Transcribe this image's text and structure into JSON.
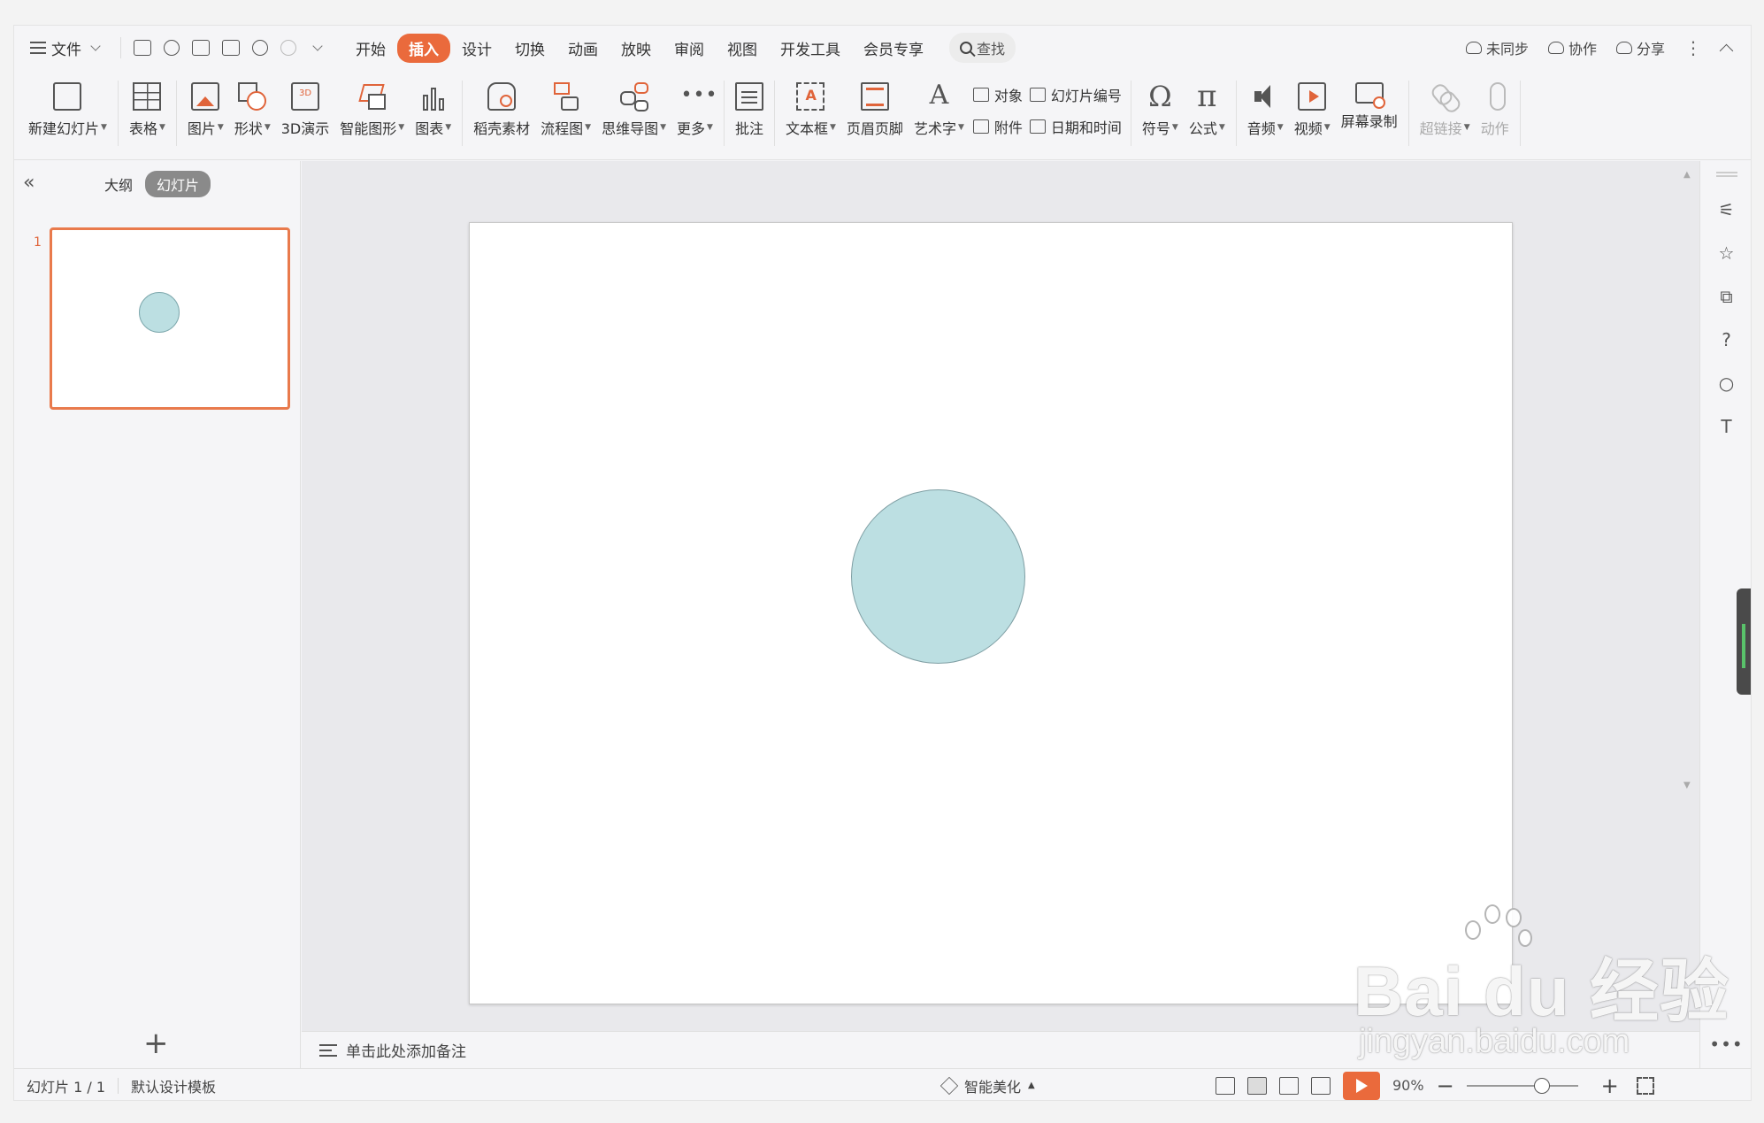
{
  "menubar": {
    "file_label": "文件",
    "tabs": [
      "开始",
      "插入",
      "设计",
      "切换",
      "动画",
      "放映",
      "审阅",
      "视图",
      "开发工具",
      "会员专享"
    ],
    "active_tab": "插入",
    "search_label": "查找",
    "right": {
      "sync_label": "未同步",
      "collab_label": "协作",
      "share_label": "分享"
    }
  },
  "ribbon": {
    "new_slide": "新建幻灯片",
    "table": "表格",
    "picture": "图片",
    "shape": "形状",
    "demo3d": "3D演示",
    "smart_graphic": "智能图形",
    "chart": "图表",
    "docer": "稻壳素材",
    "flowchart": "流程图",
    "mindmap": "思维导图",
    "more": "更多",
    "comment": "批注",
    "textbox": "文本框",
    "header_footer": "页眉页脚",
    "wordart": "艺术字",
    "object": "对象",
    "slide_number": "幻灯片编号",
    "attachment": "附件",
    "datetime": "日期和时间",
    "symbol": "符号",
    "formula": "公式",
    "audio": "音频",
    "video": "视频",
    "screen_record": "屏幕录制",
    "hyperlink": "超链接",
    "action": "动作"
  },
  "left_panel": {
    "tab_outline": "大纲",
    "tab_slides": "幻灯片",
    "slide_numbers": [
      "1"
    ]
  },
  "notes": {
    "placeholder": "单击此处添加备注"
  },
  "status": {
    "slide_counter": "幻灯片 1 / 1",
    "template": "默认设计模板",
    "beautify": "智能美化",
    "zoom": "90%"
  },
  "slide": {
    "shape": "circle",
    "fill_color": "#bcdfe2",
    "stroke_color": "#7e9ea3"
  },
  "colors": {
    "accent": "#ea6a3c"
  },
  "watermark": {
    "main": "Bai du 经验",
    "sub": "jingyan.baidu.com"
  }
}
